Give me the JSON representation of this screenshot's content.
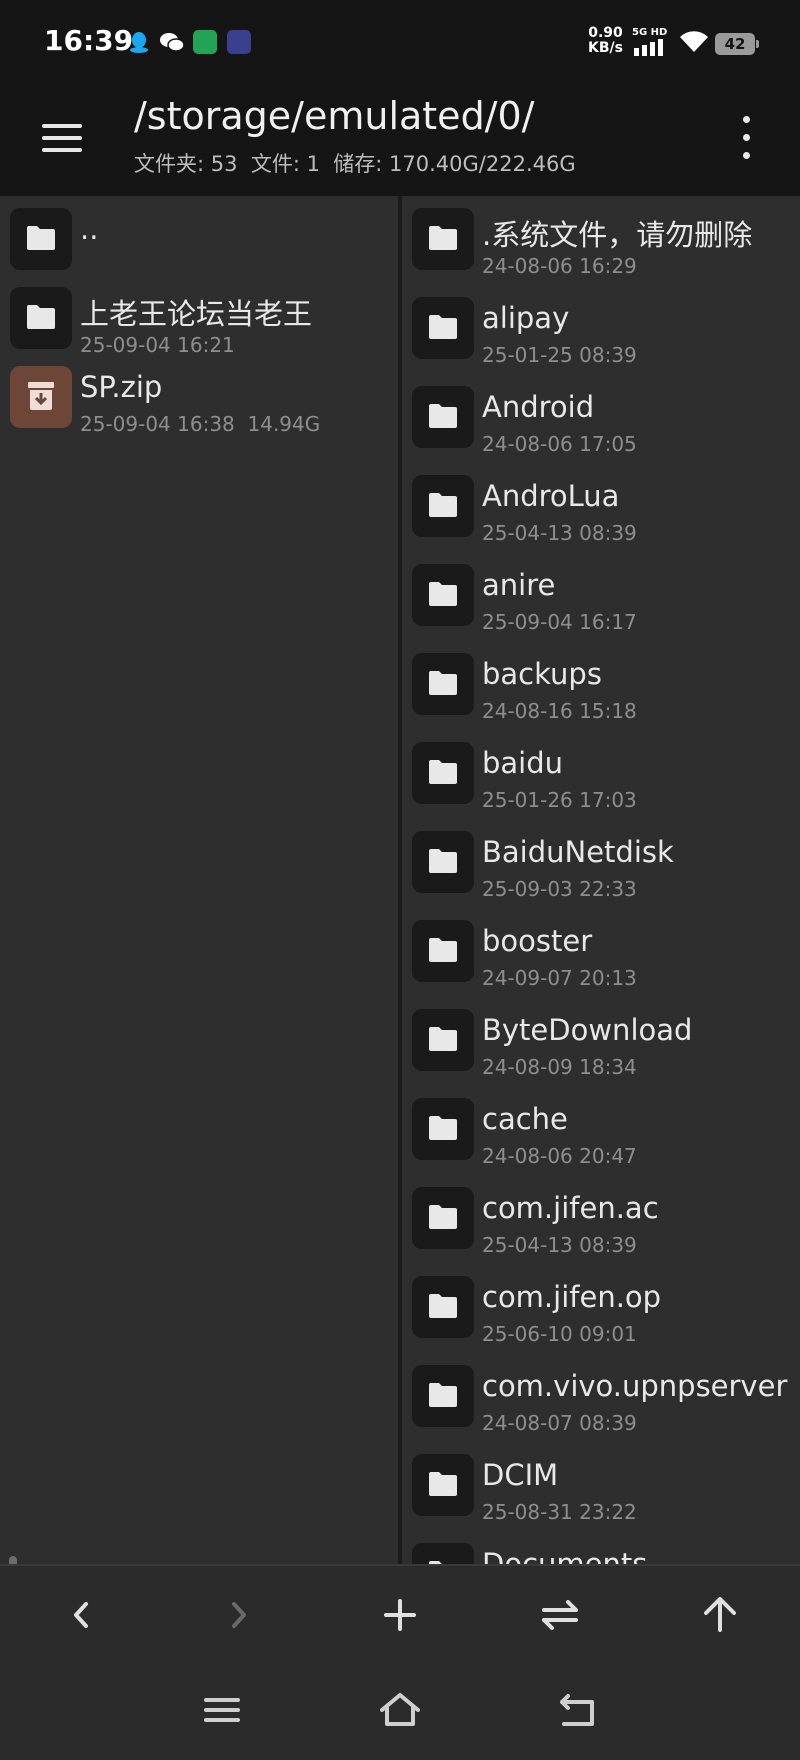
{
  "status_bar": {
    "time": "16:39",
    "net_speed_value": "0.90",
    "net_speed_unit": "KB/s",
    "network_label": "5G HD",
    "battery": "42",
    "app_icons": [
      "qq-icon",
      "wechat-icon",
      "green-app-icon",
      "purple-app-icon"
    ]
  },
  "app_bar": {
    "path": "/storage/emulated/0/",
    "info": "文件夹: 53  文件: 1  储存: 170.40G/222.46G"
  },
  "left_pane": {
    "items": [
      {
        "name": "..",
        "meta": "",
        "type": "folder"
      },
      {
        "name": "上老王论坛当老王",
        "meta": "25-09-04 16:21",
        "type": "folder"
      },
      {
        "name": "SP.zip",
        "meta": "25-09-04 16:38  14.94G",
        "type": "archive"
      }
    ]
  },
  "right_pane": {
    "items": [
      {
        "name": ".系统文件，请勿删除",
        "meta": "24-08-06 16:29",
        "type": "folder"
      },
      {
        "name": "alipay",
        "meta": "25-01-25 08:39",
        "type": "folder"
      },
      {
        "name": "Android",
        "meta": "24-08-06 17:05",
        "type": "folder"
      },
      {
        "name": "AndroLua",
        "meta": "25-04-13 08:39",
        "type": "folder"
      },
      {
        "name": "anire",
        "meta": "25-09-04 16:17",
        "type": "folder"
      },
      {
        "name": "backups",
        "meta": "24-08-16 15:18",
        "type": "folder"
      },
      {
        "name": "baidu",
        "meta": "25-01-26 17:03",
        "type": "folder"
      },
      {
        "name": "BaiduNetdisk",
        "meta": "25-09-03 22:33",
        "type": "folder"
      },
      {
        "name": "booster",
        "meta": "24-09-07 20:13",
        "type": "folder"
      },
      {
        "name": "ByteDownload",
        "meta": "24-08-09 18:34",
        "type": "folder"
      },
      {
        "name": "cache",
        "meta": "24-08-06 20:47",
        "type": "folder"
      },
      {
        "name": "com.jifen.ac",
        "meta": "25-04-13 08:39",
        "type": "folder"
      },
      {
        "name": "com.jifen.op",
        "meta": "25-06-10 09:01",
        "type": "folder"
      },
      {
        "name": "com.vivo.upnpserver",
        "meta": "24-08-07 08:39",
        "type": "folder"
      },
      {
        "name": "DCIM",
        "meta": "25-08-31 23:22",
        "type": "folder"
      },
      {
        "name": "Documents",
        "meta": "",
        "type": "folder"
      }
    ]
  },
  "toolbar": {
    "buttons": [
      "back-icon",
      "forward-icon",
      "add-icon",
      "swap-icon",
      "up-icon"
    ]
  },
  "nav_bar": {
    "buttons": [
      "recents-icon",
      "home-icon",
      "return-icon"
    ]
  },
  "colors": {
    "bar_bg": "#151515",
    "pane_bg": "#2e2e2e",
    "tile_bg": "#1a1a1a",
    "archive_tile_bg": "#6e4637",
    "text_primary": "#e8e8e8",
    "text_secondary": "#8e8e8e"
  }
}
